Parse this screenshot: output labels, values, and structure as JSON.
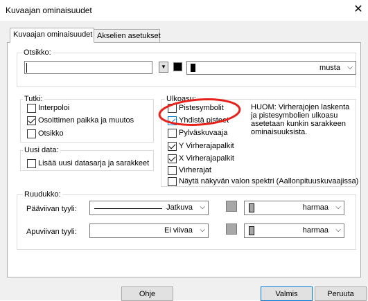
{
  "window": {
    "title": "Kuvaajan ominaisuudet",
    "close_glyph": "✕"
  },
  "tabs": [
    {
      "label": "Kuvaajan ominaisuudet",
      "active": true
    },
    {
      "label": "Akselien asetukset",
      "active": false
    }
  ],
  "otsikko": {
    "label": "Otsikko:",
    "value": "",
    "color_name": "musta",
    "color_hex": "#000000"
  },
  "tutki": {
    "label": "Tutki:",
    "items": [
      {
        "label": "Interpoloi",
        "checked": false
      },
      {
        "label": "Osoittimen paikka ja muutos",
        "checked": true
      },
      {
        "label": "Otsikko",
        "checked": false
      }
    ]
  },
  "uusi_data": {
    "label": "Uusi data:",
    "items": [
      {
        "label": "Lisää uusi datasarja ja sarakkeet",
        "checked": false
      }
    ]
  },
  "ulkoasu": {
    "label": "Ulkoasu:",
    "items": [
      {
        "label": "Pistesymbolit",
        "checked": false
      },
      {
        "label": "Yhdistä pisteet",
        "checked": true
      },
      {
        "label": "Pylväskuvaaja",
        "checked": false
      },
      {
        "label": "Y Virherajapalkit",
        "checked": true
      },
      {
        "label": "X Virherajapalkit",
        "checked": true
      },
      {
        "label": "Virherajat",
        "checked": false
      },
      {
        "label": "Näytä näkyvän valon spektri (Aallonpituuskuvaajissa)",
        "checked": false
      }
    ],
    "note": [
      "HUOM: Virherajojen laskenta",
      "ja pistesymbolien ulkoasu",
      "asetetaan kunkin sarakkeen",
      "ominaisuuksista."
    ]
  },
  "ruudukko": {
    "label": "Ruudukko:",
    "rows": [
      {
        "label": "Pääviivan tyyli:",
        "style": "Jatkuva",
        "color_name": "harmaa",
        "color_hex": "#a8a8a8"
      },
      {
        "label": "Apuviivan tyyli:",
        "style": "Ei viivaa",
        "color_name": "harmaa",
        "color_hex": "#a8a8a8"
      }
    ]
  },
  "buttons": {
    "help": "Ohje",
    "ok": "Valmis",
    "cancel": "Peruuta"
  },
  "colors": {
    "highlight_ring": "#e8221b",
    "accent": "#0078d7"
  }
}
